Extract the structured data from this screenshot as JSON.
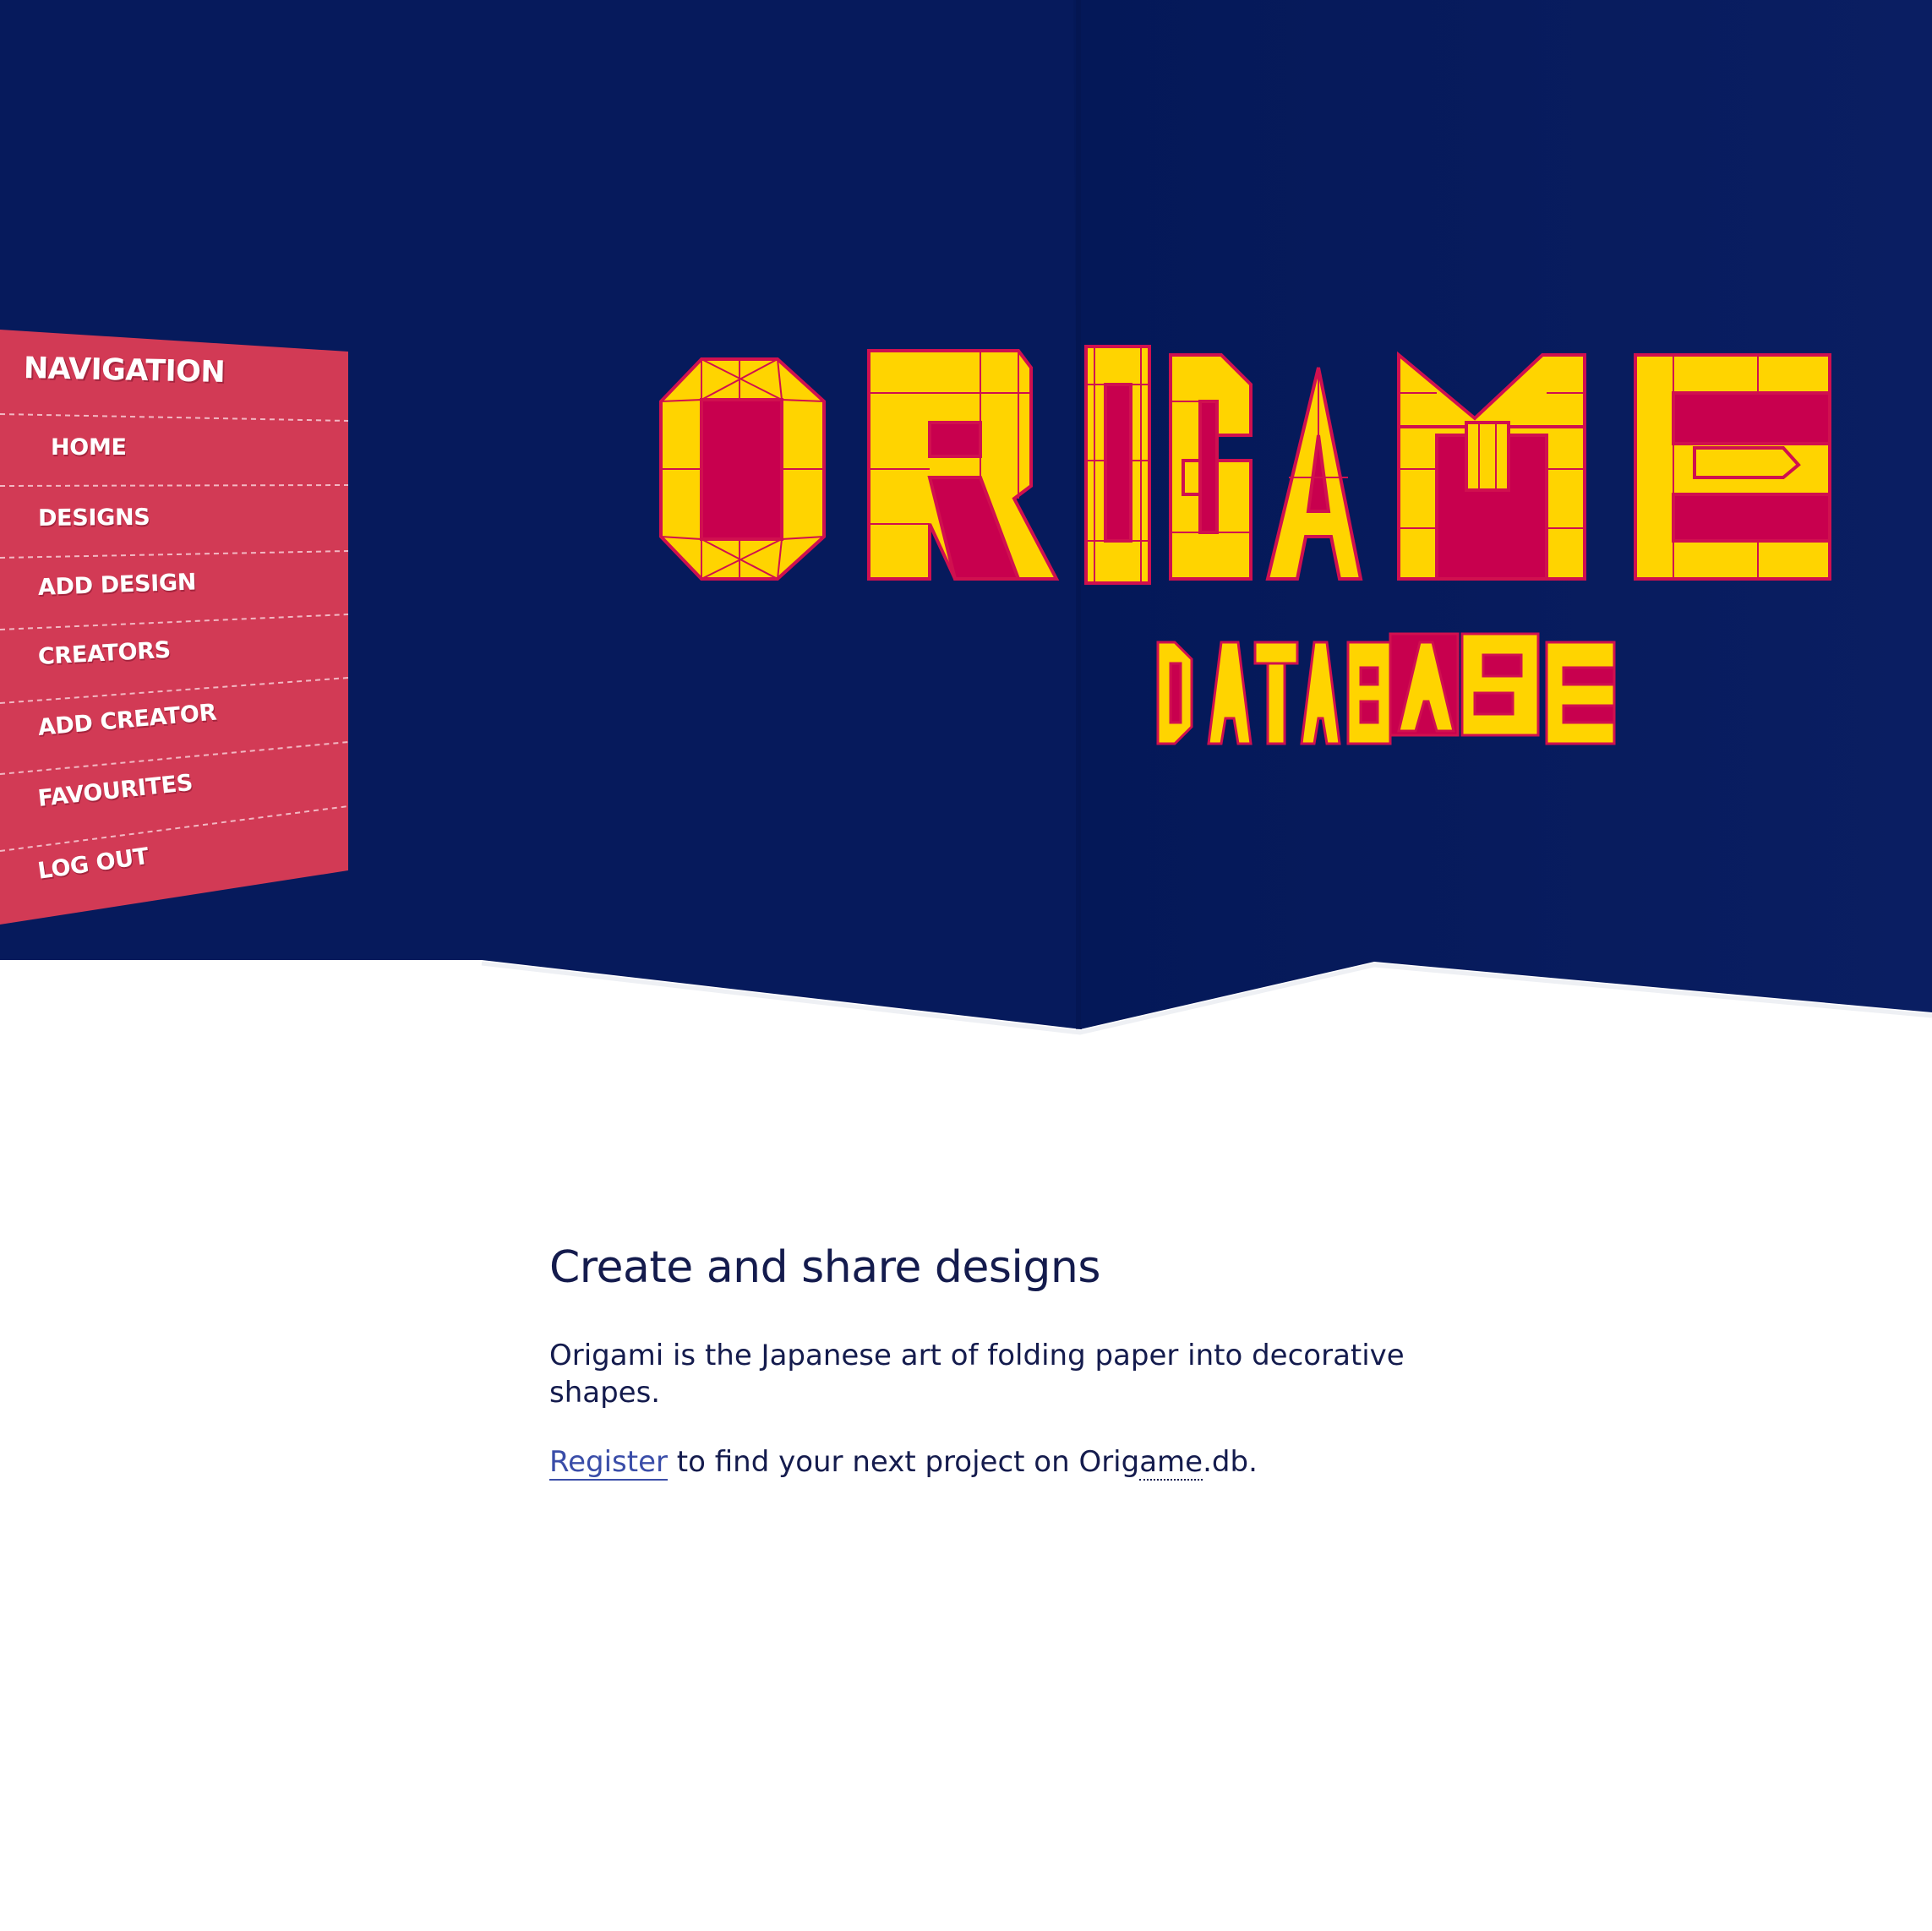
{
  "colors": {
    "hero_background": "#061a5c",
    "hero_dark_fold": "#051956",
    "nav_background": "#d23a55",
    "logo_fill": "#ffd400",
    "logo_outline": "#d0104f",
    "text_primary": "#141b4d",
    "link": "#3a4da8"
  },
  "logo": {
    "title": "ORIGAME",
    "subtitle": "DATABASE"
  },
  "nav": {
    "title": "NAVIGATION",
    "items": [
      {
        "label": "HOME"
      },
      {
        "label": "DESIGNS"
      },
      {
        "label": "ADD DESIGN"
      },
      {
        "label": "CREATORS"
      },
      {
        "label": "ADD CREATOR"
      },
      {
        "label": "FAVOURITES"
      },
      {
        "label": "LOG OUT"
      }
    ]
  },
  "main": {
    "heading": "Create and share designs",
    "intro": "Origami is the Japanese art of folding paper into decorative shapes.",
    "register_link": "Register",
    "cta_middle": " to find your next project on Orig",
    "cta_abbr": "ame",
    "cta_end": ".db."
  }
}
